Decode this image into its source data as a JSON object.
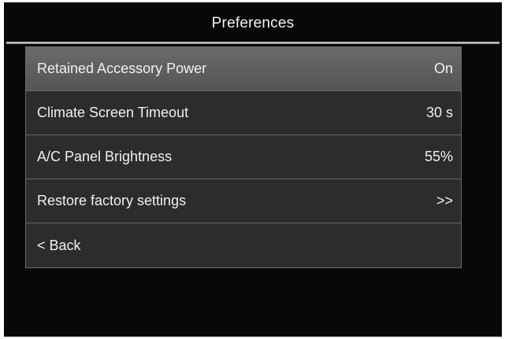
{
  "header": {
    "title": "Preferences"
  },
  "menu": {
    "items": [
      {
        "label": "Retained Accessory Power",
        "value": "On",
        "selected": true
      },
      {
        "label": "Climate Screen Timeout",
        "value": "30 s",
        "selected": false
      },
      {
        "label": "A/C Panel Brightness",
        "value": "55%",
        "selected": false
      },
      {
        "label": "Restore factory settings",
        "value": ">>",
        "selected": false
      },
      {
        "label": "< Back",
        "value": "",
        "selected": false
      }
    ]
  },
  "colors": {
    "background": "#080808",
    "list_background": "#2c2c2c",
    "selected_row": "#626262",
    "divider": "#6a6a6a",
    "text": "#f0f0f0"
  }
}
